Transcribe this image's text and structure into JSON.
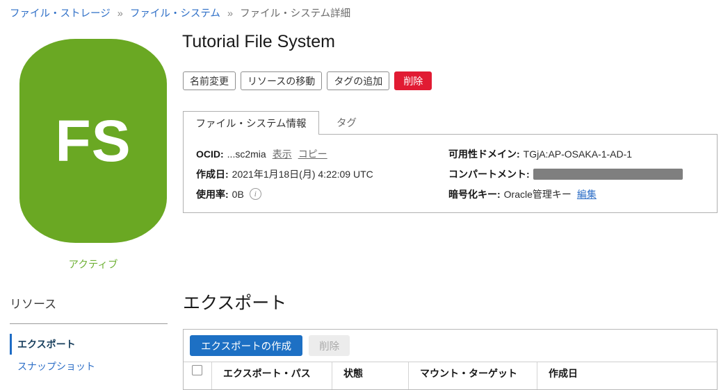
{
  "breadcrumb": {
    "separator": "»",
    "items": [
      {
        "label": "ファイル・ストレージ"
      },
      {
        "label": "ファイル・システム"
      },
      {
        "label": "ファイル・システム詳細"
      }
    ]
  },
  "entity": {
    "icon_text": "FS",
    "status_label": "アクティブ",
    "title": "Tutorial File System"
  },
  "action_bar": {
    "rename": "名前変更",
    "move_resource": "リソースの移動",
    "add_tags": "タグの追加",
    "delete": "削除"
  },
  "tabs": {
    "info": "ファイル・システム情報",
    "tags": "タグ"
  },
  "details": {
    "ocid": {
      "label": "OCID:",
      "value": "...sc2mia",
      "show_link": "表示",
      "copy_link": "コピー"
    },
    "created": {
      "label": "作成日:",
      "value": "2021年1月18日(月) 4:22:09 UTC"
    },
    "utilization": {
      "label": "使用率:",
      "value": "0B",
      "info_icon_glyph": "i"
    },
    "availability_domain": {
      "label": "可用性ドメイン:",
      "value": "TGjA:AP-OSAKA-1-AD-1"
    },
    "compartment": {
      "label": "コンパートメント:",
      "value_redacted": true
    },
    "encryption_key": {
      "label": "暗号化キー:",
      "value": "Oracle管理キー",
      "edit_link": "編集"
    }
  },
  "sidebar": {
    "heading": "リソース",
    "items": [
      {
        "label": "エクスポート",
        "active": true
      },
      {
        "label": "スナップショット",
        "active": false
      }
    ]
  },
  "exports": {
    "heading": "エクスポート",
    "create_button": "エクスポートの作成",
    "delete_button": "削除",
    "columns": [
      "エクスポート・パス",
      "状態",
      "マウント・ターゲット",
      "作成日"
    ]
  },
  "colors": {
    "brand_green": "#6aa823",
    "status_green": "#70b237",
    "link_blue": "#2e6fc7",
    "primary_blue": "#1d70c4",
    "danger_red": "#e11b33",
    "redacted_gray": "#7f7f7f"
  }
}
